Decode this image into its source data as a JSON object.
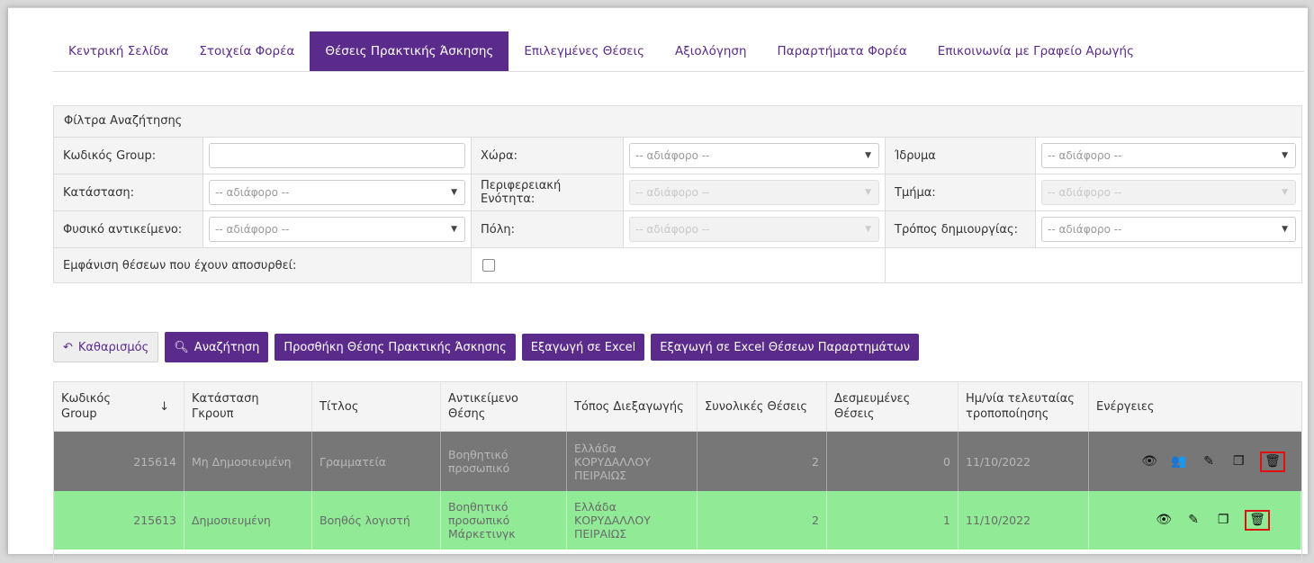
{
  "nav": {
    "tabs": [
      {
        "label": "Κεντρική Σελίδα"
      },
      {
        "label": "Στοιχεία Φορέα"
      },
      {
        "label": "Θέσεις Πρακτικής Άσκησης"
      },
      {
        "label": "Επιλεγμένες Θέσεις"
      },
      {
        "label": "Αξιολόγηση"
      },
      {
        "label": "Παραρτήματα Φορέα"
      },
      {
        "label": "Επικοινωνία με Γραφείο Αρωγής"
      }
    ],
    "active_tab": "Θέσεις Πρακτικής Άσκησης"
  },
  "filters": {
    "title": "Φίλτρα Αναζήτησης",
    "group_code_label": "Κωδικός Group:",
    "group_code_value": "",
    "country_label": "Χώρα:",
    "country_value": "-- αδιάφορο --",
    "institution_label": "Ίδρυμα",
    "institution_value": "-- αδιάφορο --",
    "status_label": "Κατάσταση:",
    "status_value": "-- αδιάφορο --",
    "region_label": "Περιφερειακή Ενότητα:",
    "region_value": "-- αδιάφορο --",
    "department_label": "Τμήμα:",
    "department_value": "-- αδιάφορο --",
    "object_label": "Φυσικό αντικείμενο:",
    "object_value": "-- αδιάφορο --",
    "city_label": "Πόλη:",
    "city_value": "-- αδιάφορο --",
    "creation_label": "Τρόπος δημιουργίας:",
    "creation_value": "-- αδιάφορο --",
    "withdrawn_label": "Εμφάνιση θέσεων που έχουν αποσυρθεί:"
  },
  "buttons": {
    "clear": "Καθαρισμός",
    "search": "Αναζήτηση",
    "add": "Προσθήκη Θέσης Πρακτικής Άσκησης",
    "export": "Εξαγωγή σε Excel",
    "export_annex": "Εξαγωγή σε Excel Θέσεων Παραρτημάτων"
  },
  "table": {
    "headers": {
      "code": "Κωδικός Group",
      "sort_indicator": "↓",
      "status": "Κατάσταση Γκρουπ",
      "title": "Τίτλος",
      "object": "Αντικείμενο Θέσης",
      "location": "Τόπος Διεξαγωγής",
      "total": "Συνολικές Θέσεις",
      "reserved": "Δεσμευμένες Θέσεις",
      "modified": "Ημ/νία τελευταίας τροποποίησης",
      "actions": "Ενέργειες"
    },
    "rows": [
      {
        "code": "215614",
        "status": "Μη Δημοσιευμένη",
        "title": "Γραμματεία",
        "object": "Βοηθητικό προσωπικό",
        "location": "Ελλάδα ΚΟΡΥΔΑΛΛΟΥ ΠΕΙΡΑΙΩΣ",
        "total": "2",
        "reserved": "0",
        "modified": "11/10/2022"
      },
      {
        "code": "215613",
        "status": "Δημοσιευμένη",
        "title": "Βοηθός λογιστή",
        "object": "Βοηθητικό προσωπικό Μάρκετινγκ",
        "location": "Ελλάδα ΚΟΡΥΔΑΛΛΟΥ ΠΕΙΡΑΙΩΣ",
        "total": "2",
        "reserved": "1",
        "modified": "11/10/2022"
      }
    ]
  },
  "colors": {
    "accent": "#5b2b8c",
    "unpublished_row": "#777777",
    "published_row": "#90ea96",
    "highlight": "#e01010"
  },
  "icons": [
    "view-icon",
    "users-icon",
    "edit-icon",
    "copy-icon",
    "delete-icon",
    "reset-icon",
    "search-icon",
    "caret-down-icon"
  ]
}
